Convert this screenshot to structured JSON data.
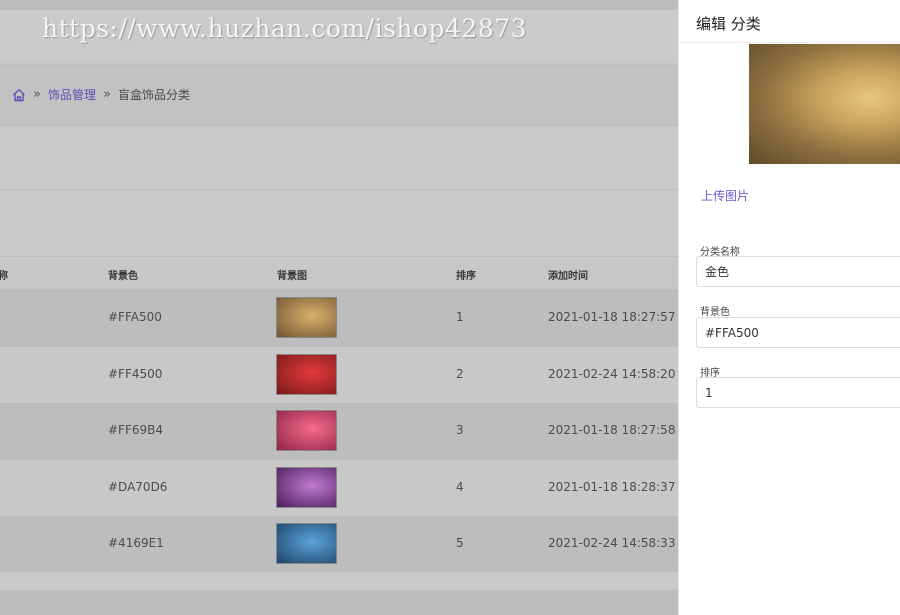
{
  "watermark": "https://www.huzhan.com/ishop42873",
  "breadcrumb": {
    "home_icon": "home-icon",
    "parent": "饰品管理",
    "current": "盲盒饰品分类"
  },
  "table": {
    "columns": [
      "名称",
      "背景色",
      "背景图",
      "排序",
      "添加时间"
    ],
    "rows": [
      {
        "bg_color": "#FFA500",
        "sort": "1",
        "added": "2021-01-18 18:27:57",
        "image_colors": [
          "#dcb06c",
          "#6e5633"
        ]
      },
      {
        "bg_color": "#FF4500",
        "sort": "2",
        "added": "2021-02-24 14:58:20",
        "image_colors": [
          "#e23a3a",
          "#7a1a1a"
        ]
      },
      {
        "bg_color": "#FF69B4",
        "sort": "3",
        "added": "2021-01-18 18:27:58",
        "image_colors": [
          "#f56b8e",
          "#8e2446"
        ]
      },
      {
        "bg_color": "#DA70D6",
        "sort": "4",
        "added": "2021-01-18 18:28:37",
        "image_colors": [
          "#c07ad0",
          "#4b1d5c"
        ]
      },
      {
        "bg_color": "#4169E1",
        "sort": "5",
        "added": "2021-02-24 14:58:33",
        "image_colors": [
          "#5ba3d8",
          "#1d4469"
        ]
      }
    ]
  },
  "drawer": {
    "title": "编辑 分类",
    "upload_label": "上传图片",
    "fields": {
      "name": {
        "label": "分类名称",
        "value": "金色"
      },
      "bg_color": {
        "label": "背景色",
        "value": "#FFA500"
      },
      "sort": {
        "label": "排序",
        "value": "1"
      }
    }
  },
  "colors": {
    "accent": "#6a5acd",
    "overlay": "#c9c9c9"
  }
}
